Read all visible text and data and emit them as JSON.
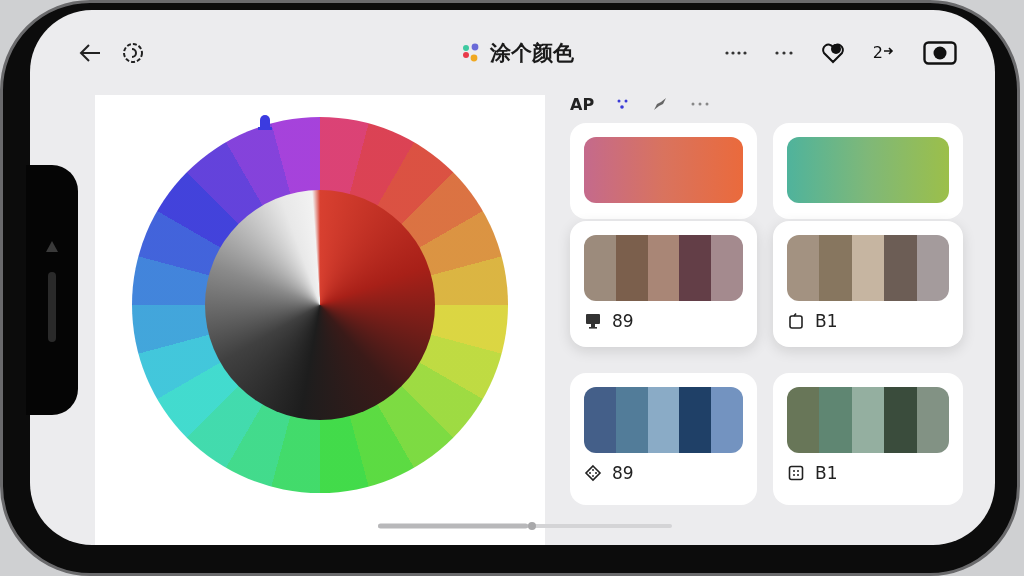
{
  "header": {
    "title": "涂个颜色",
    "counter": "2"
  },
  "toolbar": {
    "font_label": "AP"
  },
  "cards": [
    {
      "kind": "gradient",
      "swatches": [
        {
          "color": "#c46a8c"
        },
        {
          "color": "#d9735e"
        },
        {
          "color": "#ea6a3c"
        }
      ]
    },
    {
      "kind": "gradient",
      "swatches": [
        {
          "color": "#4fb39c"
        },
        {
          "color": "#7fb878"
        },
        {
          "color": "#9cbf4a"
        }
      ]
    },
    {
      "kind": "stripes",
      "label": "89",
      "swatches": [
        {
          "color": "#9c8b7c"
        },
        {
          "color": "#7b5f4c"
        },
        {
          "color": "#a98676"
        },
        {
          "color": "#633e47"
        },
        {
          "color": "#a48a8e"
        }
      ]
    },
    {
      "kind": "stripes",
      "label": "B1",
      "swatches": [
        {
          "color": "#a39281"
        },
        {
          "color": "#87765f"
        },
        {
          "color": "#c6b5a1"
        },
        {
          "color": "#6c5d55"
        },
        {
          "color": "#a49b9c"
        }
      ]
    },
    {
      "kind": "stripes",
      "label": "89",
      "swatches": [
        {
          "color": "#445f89"
        },
        {
          "color": "#527c99"
        },
        {
          "color": "#8aabc6"
        },
        {
          "color": "#1f4067"
        },
        {
          "color": "#7393c0"
        }
      ]
    },
    {
      "kind": "stripes",
      "label": "B1",
      "swatches": [
        {
          "color": "#687658"
        },
        {
          "color": "#5f8672"
        },
        {
          "color": "#94afa0"
        },
        {
          "color": "#3a4c3c"
        },
        {
          "color": "#829284"
        }
      ]
    }
  ]
}
